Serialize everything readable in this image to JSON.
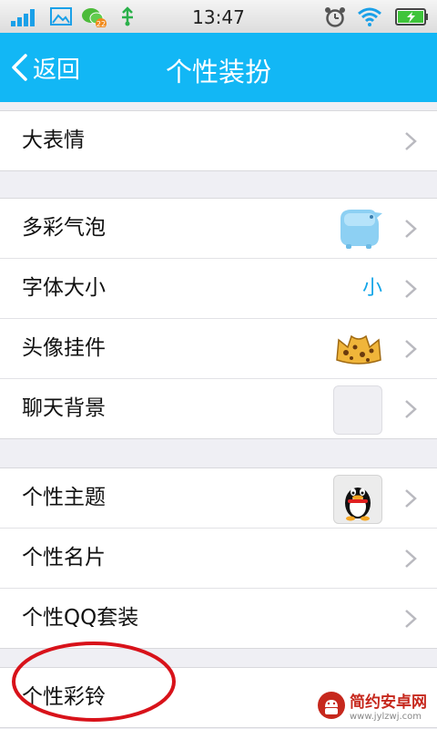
{
  "status_bar": {
    "time": "13:47",
    "notification_count": "22",
    "icons": [
      "signal-icon",
      "gallery-icon",
      "wechat-icon",
      "usb-icon",
      "alarm-icon",
      "wifi-icon",
      "battery-icon"
    ]
  },
  "header": {
    "back_label": "返回",
    "title": "个性装扮",
    "background": "#12b7f5"
  },
  "groups": [
    {
      "rows": [
        {
          "label": "大表情"
        }
      ]
    },
    {
      "rows": [
        {
          "label": "多彩气泡",
          "thumb": "bubble-thumb"
        },
        {
          "label": "字体大小",
          "value": "小"
        },
        {
          "label": "头像挂件",
          "thumb": "pendant-thumb"
        },
        {
          "label": "聊天背景",
          "thumb": "chat-background-thumb"
        }
      ]
    },
    {
      "rows": [
        {
          "label": "个性主题",
          "thumb": "theme-thumb"
        },
        {
          "label": "个性名片"
        },
        {
          "label": "个性QQ套装"
        }
      ]
    },
    {
      "rows": [
        {
          "label": "个性彩铃"
        }
      ]
    }
  ],
  "watermark": {
    "name": "简约安卓网",
    "url": "www.jylzwj.com"
  },
  "colors": {
    "accent": "#12b7f5",
    "value_text": "#12a5e8",
    "highlight_ring": "#d8121a"
  }
}
